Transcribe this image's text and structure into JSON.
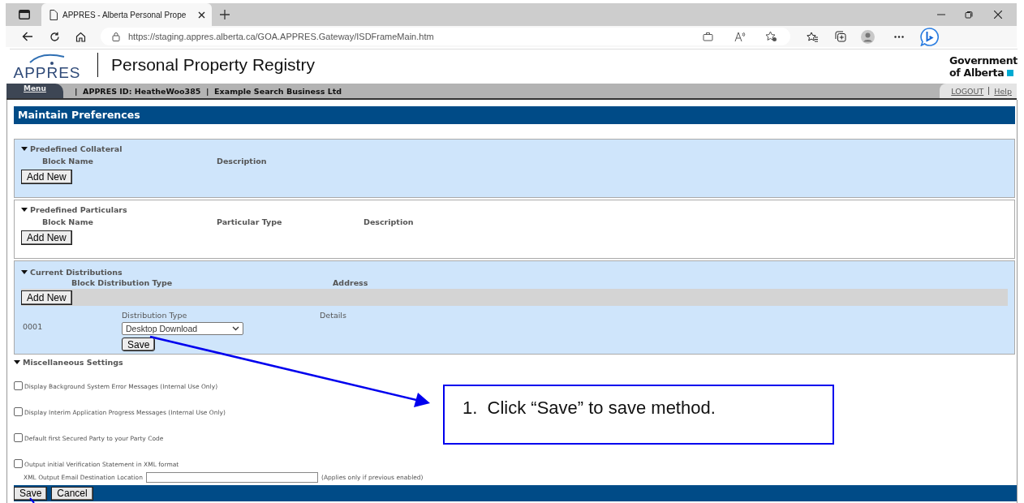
{
  "browser": {
    "tab_title": "APPRES - Alberta Personal Prope",
    "url": "https://staging.appres.alberta.ca/GOA.APPRES.Gateway/ISDFrameMain.htm"
  },
  "header": {
    "logo": "APPRES",
    "title": "Personal Property Registry",
    "government": [
      "Government",
      "of Alberta"
    ]
  },
  "navbar": {
    "menu": "Menu",
    "account": "|  APPRES ID: HeatheWoo385  |  Example Search Business Ltd",
    "links": [
      "LOGOUT",
      "Help"
    ]
  },
  "page_title": "Maintain Preferences",
  "sections": [
    {
      "kind": "table",
      "title": "Predefined Collateral",
      "columns": [
        "Block  Name",
        "Description"
      ],
      "button": "Add New"
    },
    {
      "kind": "table",
      "title": "Predefined Particulars",
      "columns": [
        "Block  Name",
        "Particular Type",
        "Description"
      ],
      "button": "Add New"
    },
    {
      "kind": "distribution",
      "title": "Current Distributions",
      "columns": [
        "Block Distribution Type",
        "Address"
      ],
      "button": "Add New",
      "rows": [
        {
          "number": "0001",
          "type_label": "Distribution Type",
          "details_label": "Details",
          "type_value": "Desktop Download",
          "save": "Save"
        }
      ]
    }
  ],
  "misc": {
    "title": "Miscellaneous Settings",
    "settings": [
      {
        "label": "Display Background System Error Messages (Internal Use Only)",
        "checked": false
      },
      {
        "label": "Display Interim Application Progress Messages (Internal Use Only)",
        "checked": false
      },
      {
        "label": "Default first Secured Party to your Party Code",
        "checked": false
      },
      {
        "label": "Output initial Verification Statement in XML format",
        "checked": false
      }
    ],
    "email_label": "XML Output Email Destination Location",
    "email_note": "(Applies only if previous enabled)"
  },
  "footer_buttons": [
    "Save",
    "Cancel"
  ],
  "callout": "1.  Click “Save” to save method."
}
